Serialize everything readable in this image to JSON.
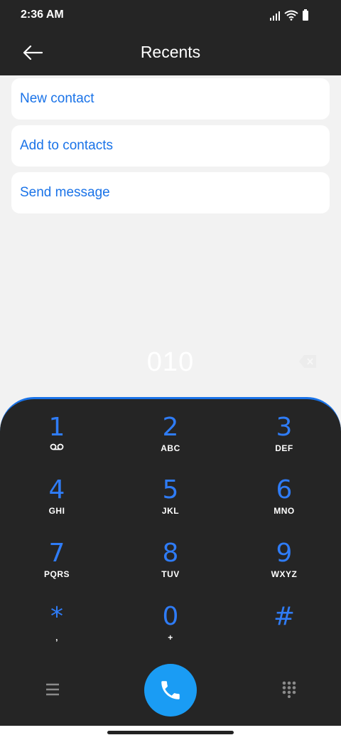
{
  "status_bar": {
    "time": "2:36 AM"
  },
  "app_bar": {
    "title": "Recents"
  },
  "actions": [
    {
      "label": "New contact"
    },
    {
      "label": "Add to contacts"
    },
    {
      "label": "Send message"
    }
  ],
  "dialer": {
    "number": "010"
  },
  "keys": [
    {
      "digit": "1",
      "letters": ""
    },
    {
      "digit": "2",
      "letters": "ABC"
    },
    {
      "digit": "3",
      "letters": "DEF"
    },
    {
      "digit": "4",
      "letters": "GHI"
    },
    {
      "digit": "5",
      "letters": "JKL"
    },
    {
      "digit": "6",
      "letters": "MNO"
    },
    {
      "digit": "7",
      "letters": "PQRS"
    },
    {
      "digit": "8",
      "letters": "TUV"
    },
    {
      "digit": "9",
      "letters": "WXYZ"
    },
    {
      "digit": "*",
      "letters": ","
    },
    {
      "digit": "0",
      "letters": "+"
    },
    {
      "digit": "#",
      "letters": ""
    }
  ],
  "icons": {
    "back": "arrow-left-icon",
    "voicemail": "voicemail-icon",
    "backspace": "backspace-icon",
    "menu": "menu-icon",
    "call": "phone-icon",
    "dialpad": "dialpad-icon"
  },
  "colors": {
    "accent": "#1a73e8",
    "digit": "#2f7cf6",
    "call_button": "#1a9cf4",
    "dark_surface": "#252525",
    "background": "#f2f2f2"
  }
}
